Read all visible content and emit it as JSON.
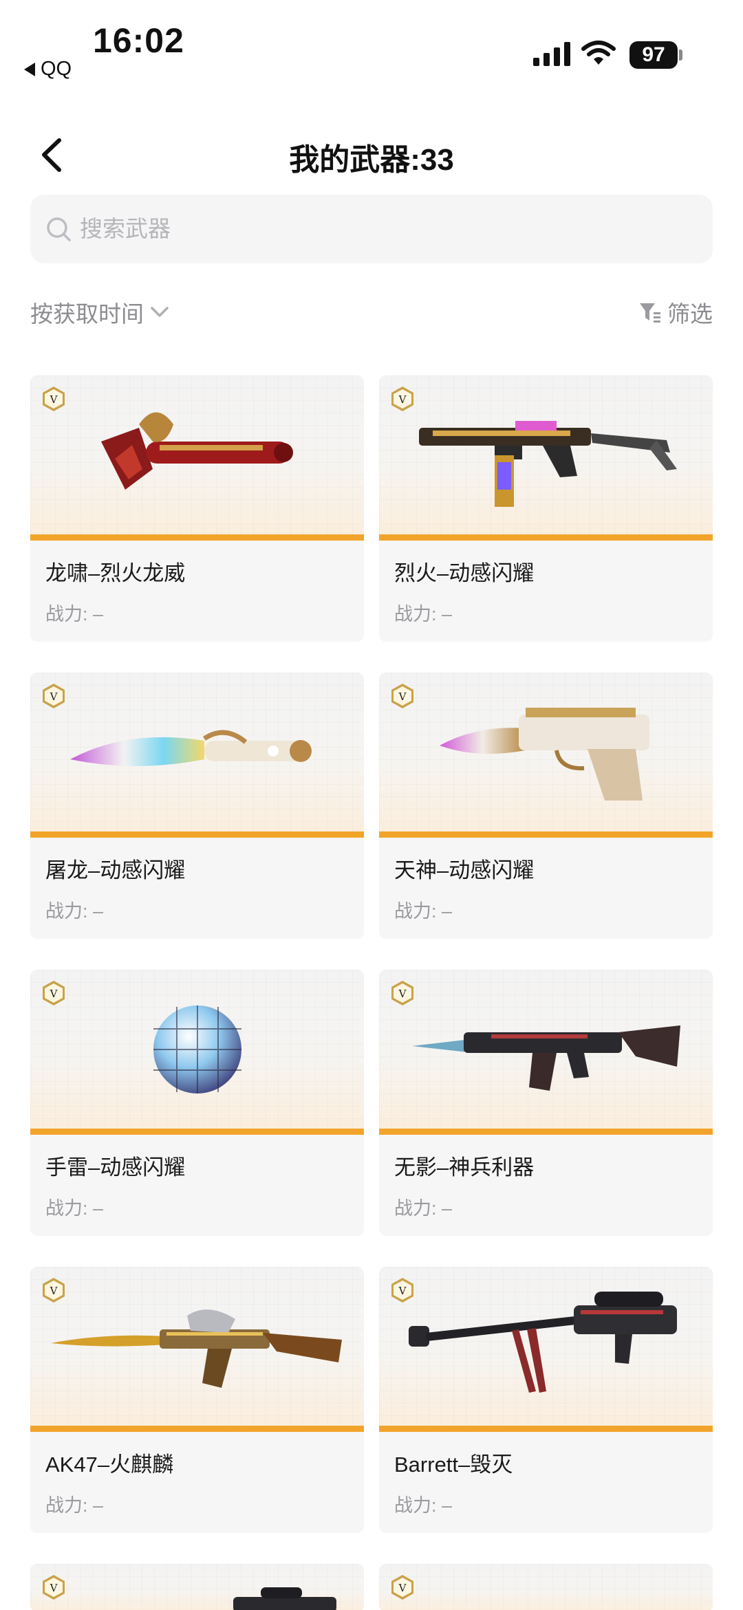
{
  "status_bar": {
    "time": "16:02",
    "back_app": "QQ",
    "battery": "97"
  },
  "nav": {
    "title": "我的武器:33"
  },
  "search": {
    "placeholder": "搜索武器",
    "value": ""
  },
  "sort": {
    "label": "按获取时间"
  },
  "filter": {
    "label": "筛选"
  },
  "power_label": "战力: –",
  "weapons": [
    {
      "name": "龙啸–烈火龙威",
      "icon": "axe-icon"
    },
    {
      "name": "烈火–动感闪耀",
      "icon": "smg-icon"
    },
    {
      "name": "屠龙–动感闪耀",
      "icon": "knife-icon"
    },
    {
      "name": "天神–动感闪耀",
      "icon": "pistol-icon"
    },
    {
      "name": "手雷–动感闪耀",
      "icon": "grenade-icon"
    },
    {
      "name": "无影–神兵利器",
      "icon": "rifle-icon"
    },
    {
      "name": "AK47–火麒麟",
      "icon": "ak47-icon"
    },
    {
      "name": "Barrett–毁灭",
      "icon": "sniper-icon"
    }
  ],
  "colors": {
    "accent_bar": "#f2a42a",
    "badge_gold": "#c9a24a"
  }
}
